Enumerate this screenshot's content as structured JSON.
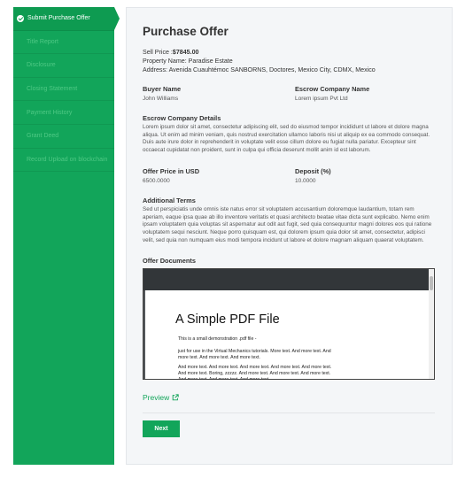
{
  "sidebar": {
    "steps": [
      {
        "label": "Submit Purchase Offer",
        "active": true
      },
      {
        "label": "Title Report",
        "active": false
      },
      {
        "label": "Disclosure",
        "active": false
      },
      {
        "label": "Closing Statement",
        "active": false
      },
      {
        "label": "Payment History",
        "active": false
      },
      {
        "label": "Grant Deed",
        "active": false
      },
      {
        "label": "Record Upload on blockchain",
        "active": false
      }
    ]
  },
  "main": {
    "title": "Purchase Offer",
    "sell_price_label": "Sell Price :",
    "sell_price_value": "$7845.00",
    "property_name": "Property Name: Paradise Estate",
    "address": "Address: Avenida Cuauhtémoc SANBORNS, Doctores, Mexico City, CDMX, Mexico",
    "buyer_label": "Buyer Name",
    "buyer_value": "John Williams",
    "escrow_company_label": "Escrow Company Name",
    "escrow_company_value": "Lorem ipsum Pvt Ltd",
    "escrow_details_label": "Escrow Company Details",
    "escrow_details_text": "Lorem ipsum dolor sit amet, consectetur adipiscing elit, sed do eiusmod tempor incididunt ut labore et dolore magna aliqua. Ut enim ad minim veniam, quis nostrud exercitation ullamco laboris nisi ut aliquip ex ea commodo consequat. Duis aute irure dolor in reprehenderit in voluptate velit esse cillum dolore eu fugiat nulla pariatur. Excepteur sint occaecat cupidatat non proident, sunt in culpa qui officia deserunt mollit anim id est laborum.",
    "offer_price_label": "Offer Price in USD",
    "offer_price_value": "6500.0000",
    "deposit_label": "Deposit (%)",
    "deposit_value": "10.0000",
    "additional_terms_label": "Additional Terms",
    "additional_terms_text": "Sed ut perspiciatis unde omnis iste natus error sit voluptatem accusantium doloremque laudantium, totam rem aperiam, eaque ipsa quae ab illo inventore veritatis et quasi architecto beatae vitae dicta sunt explicabo. Nemo enim ipsam voluptatem quia voluptas sit aspernatur aut odit aut fugit, sed quia consequuntur magni dolores eos qui ratione voluptatem sequi nesciunt. Neque porro quisquam est, qui dolorem ipsum quia dolor sit amet, consectetur, adipisci velit, sed quia non numquam eius modi tempora incidunt ut labore et dolore magnam aliquam quaerat voluptatem.",
    "offer_documents_label": "Offer Documents",
    "pdf": {
      "title": "A Simple PDF File",
      "line1": "This is a small demonstration .pdf file -",
      "line2": "just for use in the Virtual Mechanics tutorials. More text. And more text. And more text. And more text. And more text.",
      "line3": "And more text. And more text. And more text. And more text. And more text. And more text. Boring, zzzzz. And more text. And more text. And more text. And more text. And more text. And more text."
    },
    "preview_label": "Preview",
    "next_label": "Next"
  },
  "colors": {
    "accent": "#12a55a",
    "sidebar_active": "#0e9b51"
  }
}
